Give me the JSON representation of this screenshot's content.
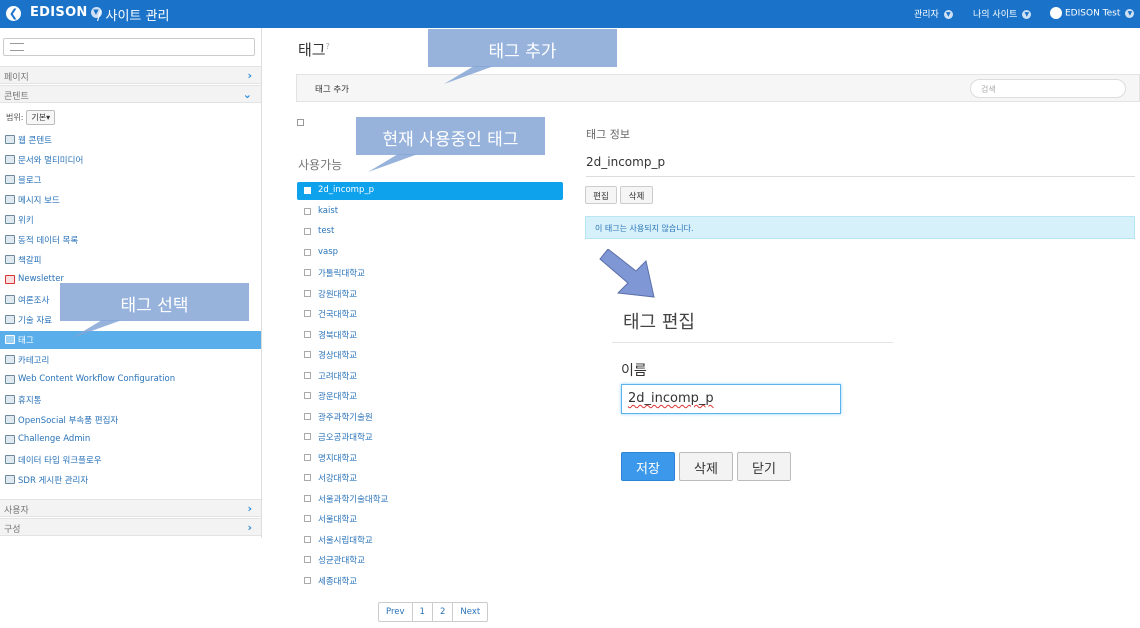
{
  "topbar": {
    "brand": "EDISON",
    "site_path": "/ 사이트 관리",
    "nav": [
      "관리자",
      "나의 사이트"
    ],
    "user": "EDISON Test"
  },
  "sidebar": {
    "panels": {
      "pages": "페이지",
      "content": "콘텐트",
      "users": "사용자",
      "config": "구성"
    },
    "scope_label": "범위:",
    "scope_value": "기본",
    "items": [
      {
        "label": "웹 콘텐트"
      },
      {
        "label": "문서와 멀티미디어"
      },
      {
        "label": "블로그"
      },
      {
        "label": "메시지 보드"
      },
      {
        "label": "위키"
      },
      {
        "label": "동적 데이터 목록"
      },
      {
        "label": "책갈피"
      },
      {
        "label": "Newsletter"
      },
      {
        "label": "여론조사"
      },
      {
        "label": "기술 자료"
      },
      {
        "label": "태그"
      },
      {
        "label": "카테고리"
      },
      {
        "label": "Web Content Workflow Configuration"
      },
      {
        "label": "휴지통"
      },
      {
        "label": "OpenSocial 부속품 편집자"
      },
      {
        "label": "Challenge Admin"
      },
      {
        "label": "데이터 타입 워크플로우"
      },
      {
        "label": "SDR 게시판 관리자"
      }
    ]
  },
  "main": {
    "title": "태그",
    "help": "?",
    "toolbar": {
      "add_tag": "태그 추가",
      "search_placeholder": "검색"
    },
    "available_title": "사용가능",
    "tags": [
      "2d_incomp_p",
      "kaist",
      "test",
      "vasp",
      "가톨릭대학교",
      "강원대학교",
      "건국대학교",
      "경북대학교",
      "경상대학교",
      "고려대학교",
      "광운대학교",
      "광주과학기술원",
      "금오공과대학교",
      "명지대학교",
      "서강대학교",
      "서울과학기술대학교",
      "서울대학교",
      "서울시립대학교",
      "성균관대학교",
      "세종대학교"
    ],
    "pagination": [
      "Prev",
      "1",
      "2",
      "Next"
    ],
    "info": {
      "label": "태그 정보",
      "name": "2d_incomp_p",
      "edit_btn": "편집",
      "delete_btn": "삭제",
      "notice": "이 태그는 사용되지 않습니다."
    },
    "edit": {
      "title": "태그 편집",
      "name_label": "이름",
      "name_value": "2d_incomp_p",
      "save": "저장",
      "delete": "삭제",
      "close": "닫기"
    }
  },
  "callouts": {
    "add_tag": "태그 추가",
    "in_use": "현재 사용중인 태그",
    "select_tag": "태그 선택"
  },
  "colors": {
    "topbar": "#1a73c9",
    "active_item": "#5aaeea",
    "active_tag": "#0ea1ec",
    "callout": "#85a6d6"
  }
}
